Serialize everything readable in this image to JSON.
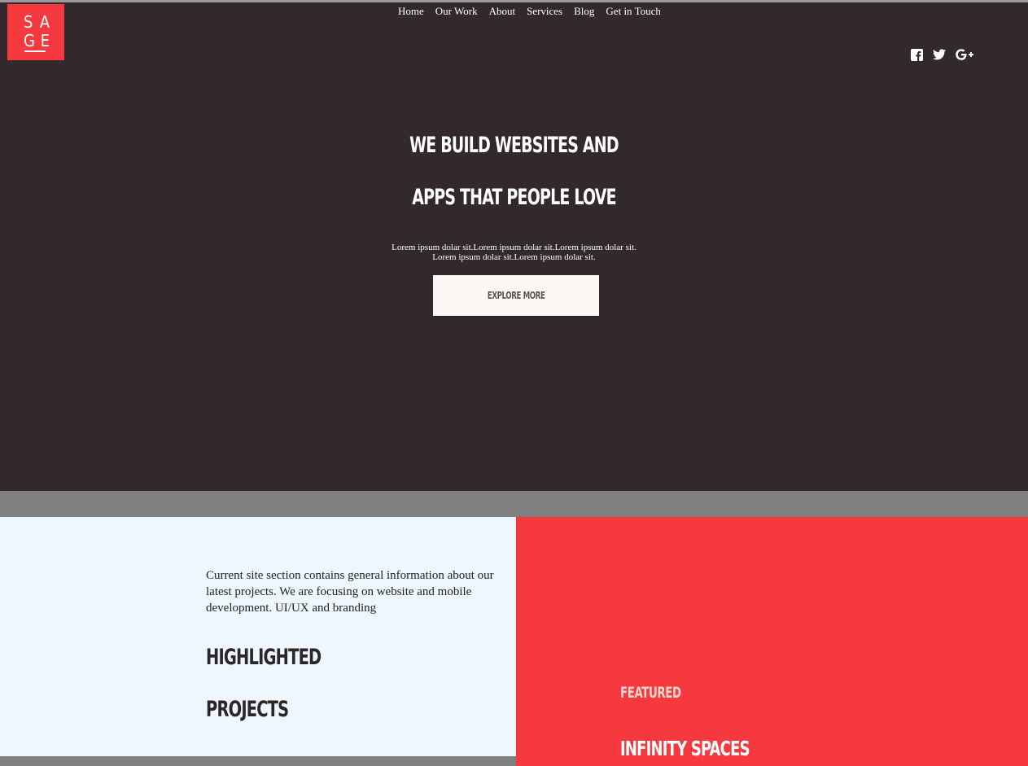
{
  "logo": {
    "letters": [
      "S",
      "A",
      "G",
      "E"
    ]
  },
  "nav": {
    "items": [
      "Home",
      "Our Work",
      "About",
      "Services",
      "Blog",
      "Get in Touch"
    ]
  },
  "social": {
    "icons": [
      "facebook-icon",
      "twitter-icon",
      "google-plus-icon"
    ]
  },
  "hero": {
    "headline_line1": "WE BUILD WEBSITES AND",
    "headline_line2": "APPS THAT PEOPLE LOVE",
    "lorem_line1": "Lorem ipsum dolar sit.Lorem ipsum dolar sit.Lorem ipsum dolar sit.",
    "lorem_line2": "Lorem ipsum dolar sit.Lorem ipsum dolar sit.",
    "button_label": "EXPLORE MORE"
  },
  "projects": {
    "intro": "Current site section contains general information about our latest projects. We are focusing on website and mobile development. UI/UX and branding",
    "title_line1": "HIGHLIGHTED",
    "title_line2": "PROJECTS"
  },
  "featured": {
    "label": "FEATURED",
    "title": "INFINITY SPACES"
  },
  "colors": {
    "hero_bg": "#31292d",
    "accent": "#f6393e",
    "light_panel": "#eef7fd"
  }
}
